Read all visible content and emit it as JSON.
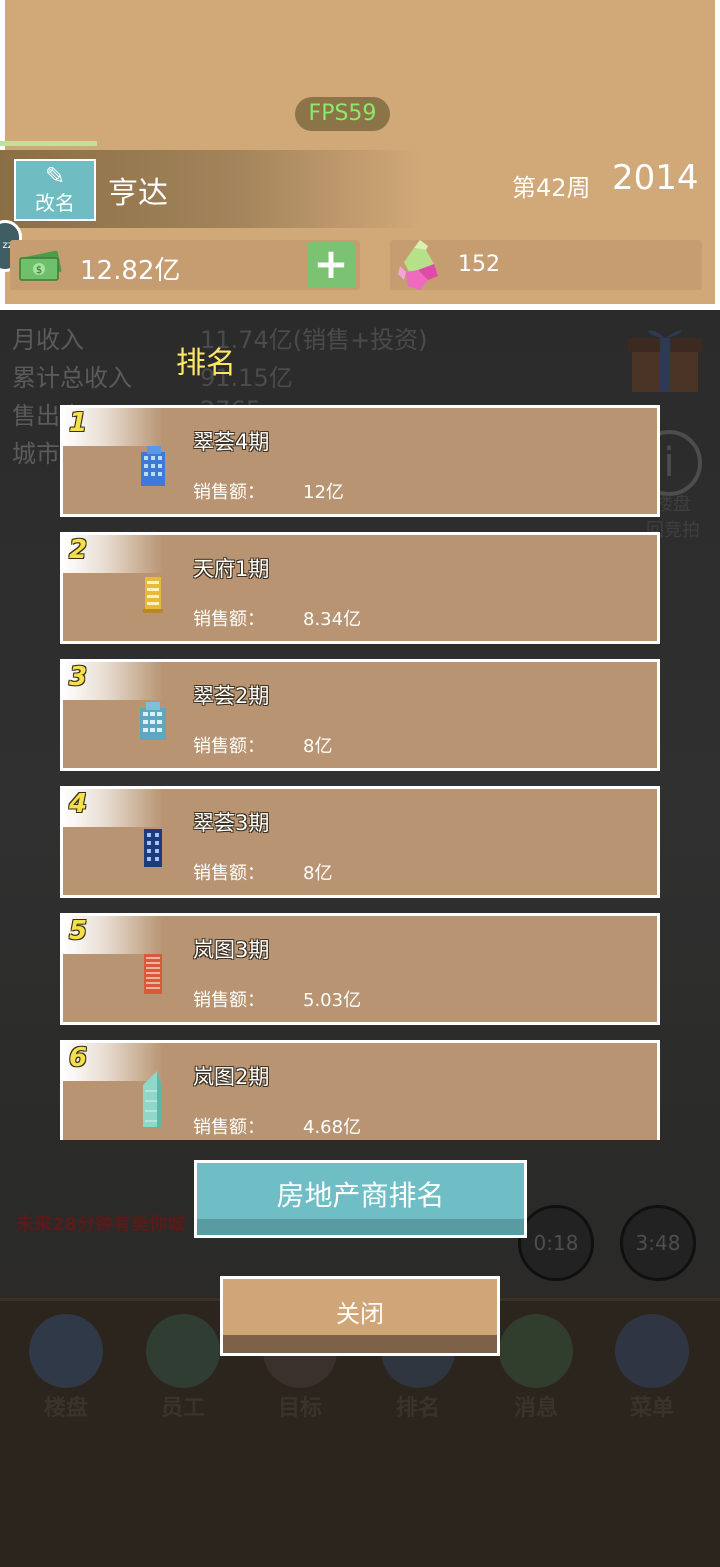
{
  "header": {
    "fps": "FPS59",
    "rename_label": "改名",
    "company_name": "亨达",
    "week": "第42周",
    "year": "2014",
    "money": "12.82亿",
    "plus": "+",
    "gems": "152"
  },
  "background": {
    "stats": [
      {
        "label": "月收入",
        "value": "11.74亿(销售+投资)"
      },
      {
        "label": "累计总收入",
        "value": "91.15亿"
      },
      {
        "label": "售出房子",
        "value": "2765"
      },
      {
        "label": "城市",
        "value": ""
      }
    ],
    "info_label": "楼盘\n回竞拍",
    "notice": "未来28分钟有美你城",
    "timers": [
      "0:18",
      "3:48"
    ],
    "nav": [
      {
        "label": "楼盘",
        "color": "#3d4a5c"
      },
      {
        "label": "员工",
        "color": "#3a4a3c"
      },
      {
        "label": "目标",
        "color": "#4a3d3a"
      },
      {
        "label": "排名",
        "color": "#3c4452"
      },
      {
        "label": "消息",
        "color": "#3b4a36"
      },
      {
        "label": "菜单",
        "color": "#3b4352"
      }
    ]
  },
  "popup": {
    "title": "排名",
    "sales_label": "销售额：",
    "rankings": [
      {
        "rank": "1",
        "name": "翠荟4期",
        "sales": "12亿",
        "building": "blue-office"
      },
      {
        "rank": "2",
        "name": "天府1期",
        "sales": "8.34亿",
        "building": "yellow-tower"
      },
      {
        "rank": "3",
        "name": "翠荟2期",
        "sales": "8亿",
        "building": "teal-office"
      },
      {
        "rank": "4",
        "name": "翠荟3期",
        "sales": "8亿",
        "building": "dark-blue-tower"
      },
      {
        "rank": "5",
        "name": "岚图3期",
        "sales": "5.03亿",
        "building": "red-tower"
      },
      {
        "rank": "6",
        "name": "岚图2期",
        "sales": "4.68亿",
        "building": "glass-skyscraper"
      }
    ],
    "developer_rank_button": "房地产商排名",
    "close_button": "关闭"
  }
}
